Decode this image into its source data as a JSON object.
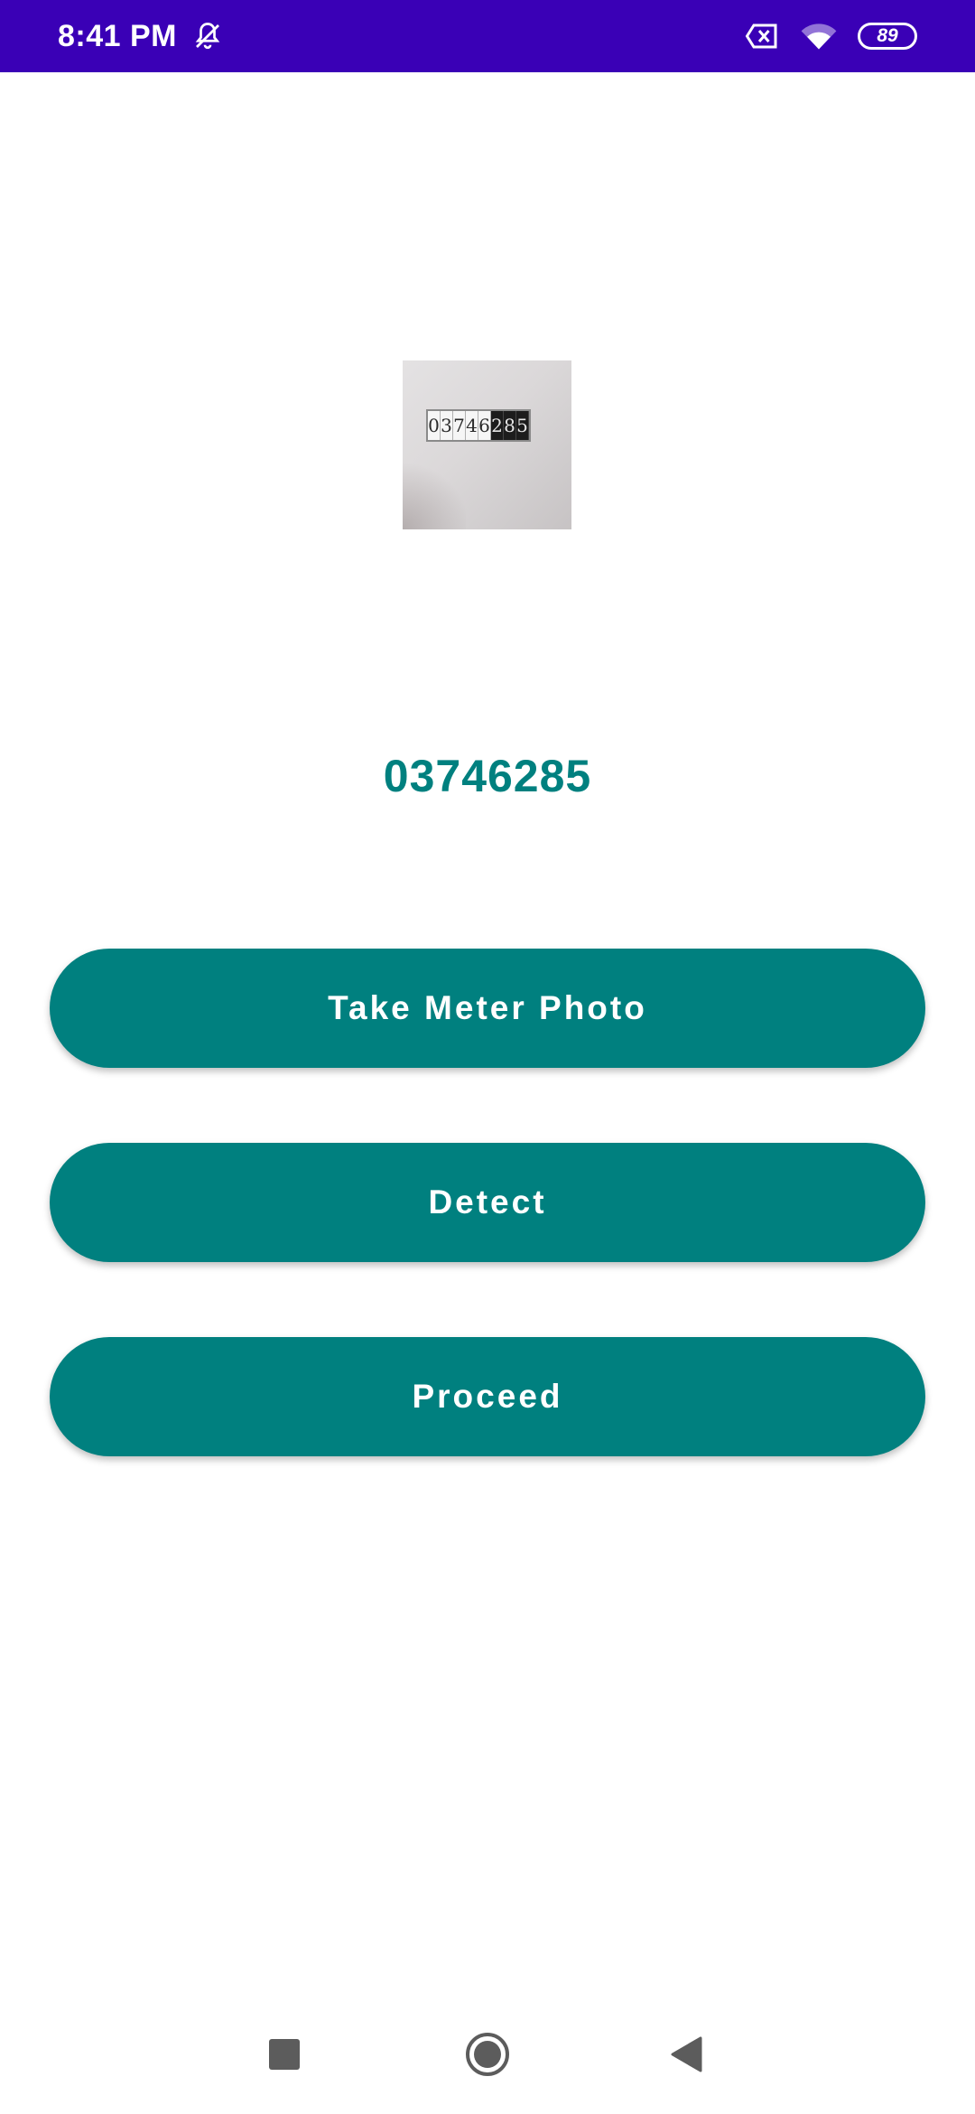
{
  "status_bar": {
    "time": "8:41 PM",
    "battery": "89",
    "icons": [
      "mute-icon",
      "sim-x-icon",
      "wifi-icon",
      "battery-icon"
    ]
  },
  "meter_image": {
    "digits": [
      "0",
      "3",
      "7",
      "4",
      "6",
      "2",
      "8",
      "5"
    ]
  },
  "reading": "03746285",
  "buttons": {
    "take_photo": "Take Meter Photo",
    "detect": "Detect",
    "proceed": "Proceed"
  },
  "nav": {
    "icons": [
      "recents-icon",
      "home-icon",
      "back-icon"
    ]
  },
  "colors": {
    "status_bar": "#3a00b6",
    "accent": "#00807f",
    "background": "#ffffff"
  }
}
